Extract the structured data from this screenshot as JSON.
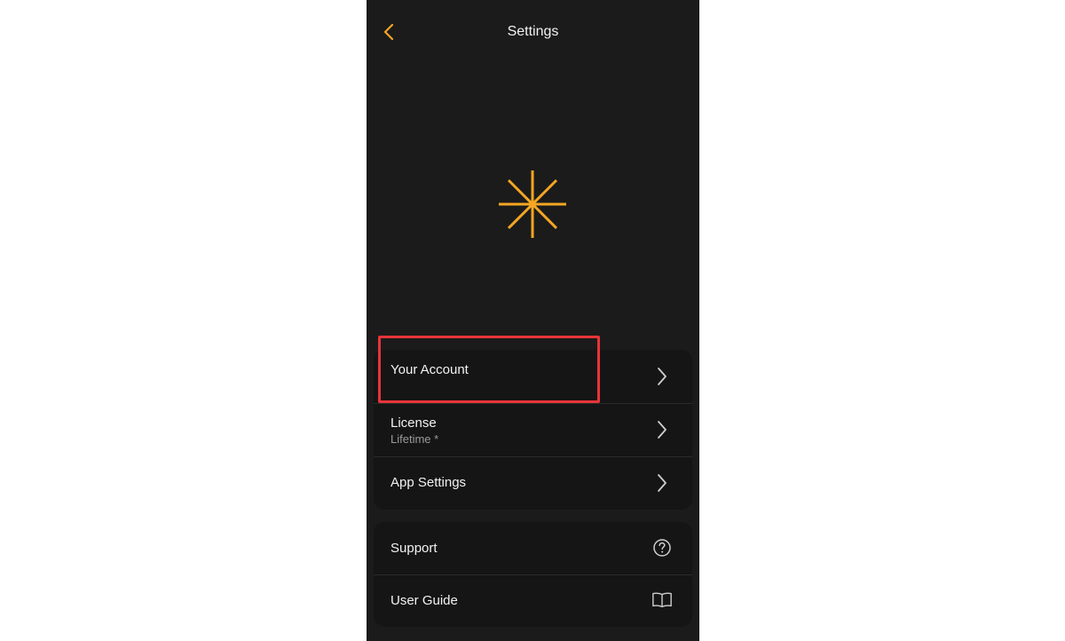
{
  "header": {
    "title": "Settings",
    "back_icon": "chevron-left-icon"
  },
  "colors": {
    "accent": "#f5a623",
    "background": "#1b1b1b",
    "card": "#151515",
    "text": "#f2f2f2",
    "subtext": "#9b9b9b",
    "highlight_border": "#e8343a"
  },
  "logo": {
    "icon": "asterisk-logo-icon"
  },
  "groups": [
    {
      "items": [
        {
          "label": "Your Account",
          "sublabel": "",
          "icon": "chevron-right-icon"
        },
        {
          "label": "License",
          "sublabel": "Lifetime *",
          "icon": "chevron-right-icon"
        },
        {
          "label": "App Settings",
          "sublabel": "",
          "icon": "chevron-right-icon"
        }
      ]
    },
    {
      "items": [
        {
          "label": "Support",
          "icon": "question-circle-icon"
        },
        {
          "label": "User Guide",
          "icon": "book-open-icon"
        }
      ]
    }
  ]
}
